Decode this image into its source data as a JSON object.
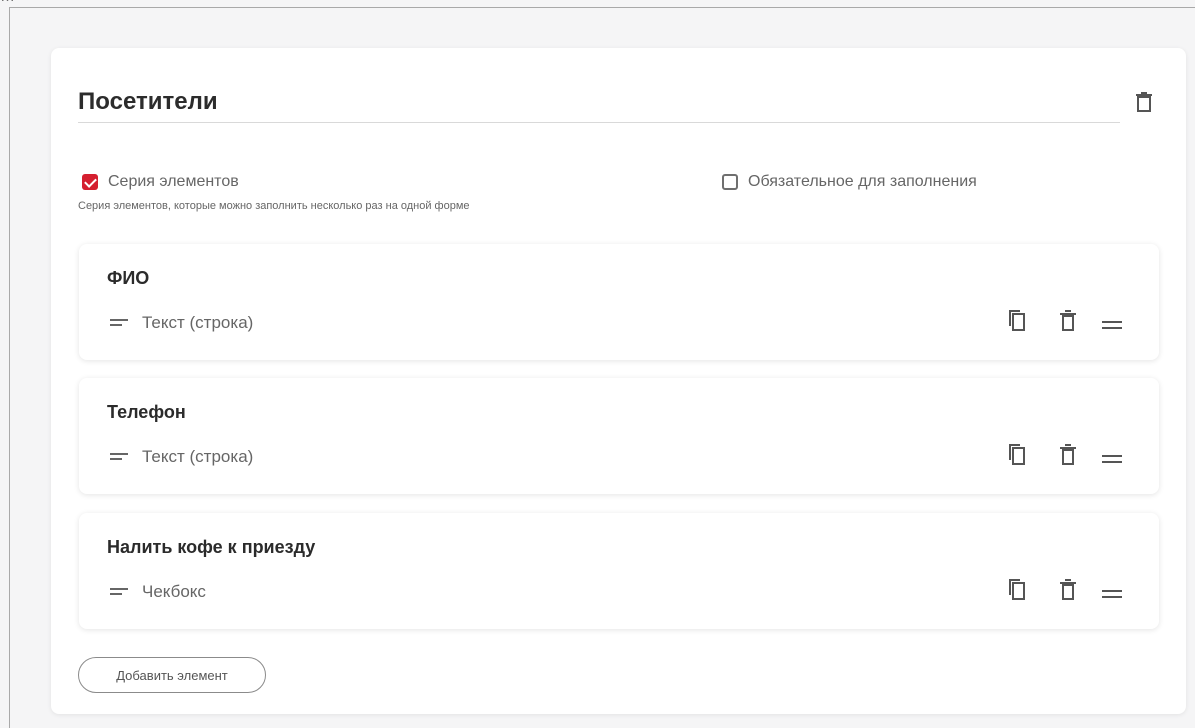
{
  "top": {
    "text": "…"
  },
  "section": {
    "title": "Посетители",
    "series_checkbox": {
      "label": "Серия элементов",
      "checked": true,
      "help": "Серия элементов, которые можно заполнить несколько раз на одной форме"
    },
    "required_checkbox": {
      "label": "Обязательное для заполнения",
      "checked": false
    }
  },
  "elements": [
    {
      "title": "ФИО",
      "type": "Текст (строка)"
    },
    {
      "title": "Телефон",
      "type": "Текст (строка)"
    },
    {
      "title": "Налить кофе к приезду",
      "type": "Чекбокс"
    }
  ],
  "buttons": {
    "add": "Добавить элемент"
  },
  "icons": {
    "delete": "trash-icon",
    "copy": "copy-icon",
    "drag": "drag-handle-icon",
    "type": "text-lines-icon"
  },
  "colors": {
    "accent": "#d51f2f",
    "background": "#f5f5f6",
    "card": "#ffffff"
  }
}
